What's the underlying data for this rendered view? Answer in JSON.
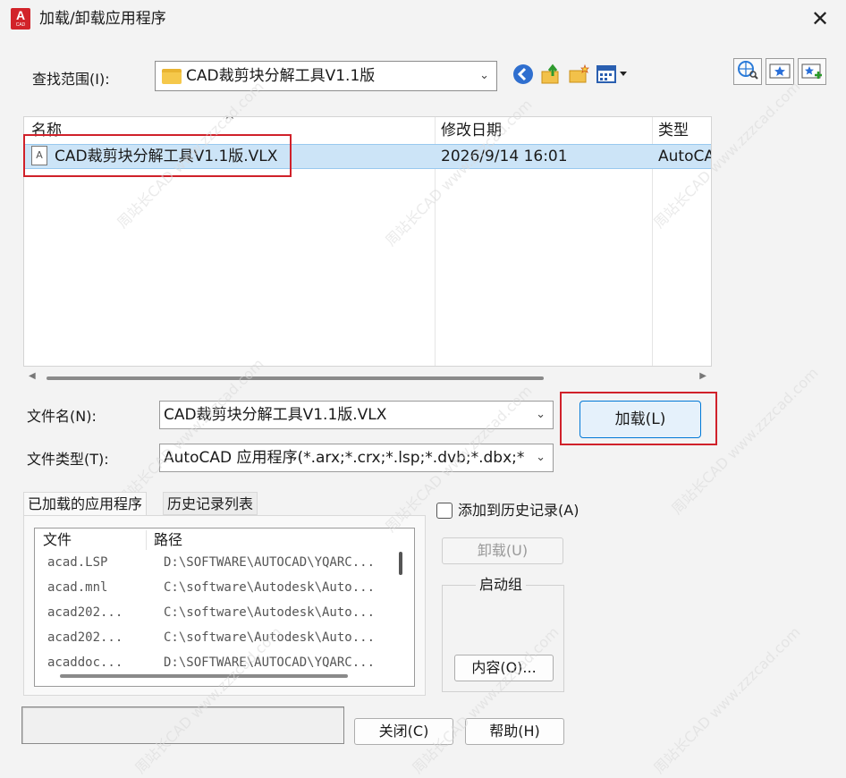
{
  "window": {
    "app_icon_letter": "A",
    "app_icon_sub": "CAD",
    "title": "加载/卸载应用程序",
    "close_glyph": "✕"
  },
  "look_in": {
    "label": "查找范围(I):",
    "value": "CAD裁剪块分解工具V1.1版"
  },
  "toolbar": [
    "back-icon",
    "up-folder-icon",
    "new-folder-icon",
    "views-menu-icon",
    "search-web-icon",
    "favorites-icon",
    "add-favorite-icon"
  ],
  "file_list": {
    "sort_arrow": "^",
    "columns": [
      "名称",
      "修改日期",
      "类型"
    ],
    "rows": [
      {
        "name": "CAD裁剪块分解工具V1.1版.VLX",
        "date": "2026/9/14 16:01",
        "type": "AutoCAD"
      }
    ]
  },
  "file_name": {
    "label": "文件名(N):",
    "value": "CAD裁剪块分解工具V1.1版.VLX"
  },
  "file_type": {
    "label": "文件类型(T):",
    "value": "AutoCAD 应用程序(*.arx;*.crx;*.lsp;*.dvb;*.dbx;*.v"
  },
  "buttons": {
    "load": "加载(L)",
    "unload": "卸载(U)",
    "contents": "内容(O)...",
    "close": "关闭(C)",
    "help": "帮助(H)"
  },
  "tabs": [
    "已加载的应用程序",
    "历史记录列表"
  ],
  "loaded_apps": {
    "columns": [
      "文件",
      "路径"
    ],
    "rows": [
      {
        "file": "acad.LSP",
        "path": "D:\\SOFTWARE\\AUTOCAD\\YQARC..."
      },
      {
        "file": "acad.mnl",
        "path": "C:\\software\\Autodesk\\Auto..."
      },
      {
        "file": "acad202...",
        "path": "C:\\software\\Autodesk\\Auto..."
      },
      {
        "file": "acad202...",
        "path": "C:\\software\\Autodesk\\Auto..."
      },
      {
        "file": "acaddoc...",
        "path": "D:\\SOFTWARE\\AUTOCAD\\YQARC..."
      }
    ]
  },
  "add_to_history": {
    "label": "添加到历史记录(A)",
    "checked": false
  },
  "startup_group": {
    "label": "启动组"
  },
  "watermark": "周站长CAD  www.zzzcad.com",
  "colors": {
    "highlight_box": "#d0212a",
    "selection": "#cce4f7",
    "primary_border": "#0078d7"
  }
}
